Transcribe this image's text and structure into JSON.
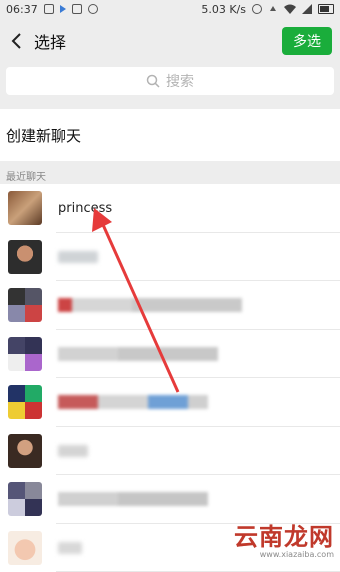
{
  "status_bar": {
    "time": "06:37",
    "network_speed": "5.03 K/s"
  },
  "header": {
    "back_icon": "chevron-left-icon",
    "title": "选择",
    "multi_select_label": "多选",
    "accent_color": "#1aad3b"
  },
  "search": {
    "placeholder": "搜索",
    "icon": "search-icon"
  },
  "create_new_chat": "创建新聊天",
  "recent_chats_label": "最近聊天",
  "chats": [
    {
      "name": "princess",
      "avatar": "portrait-brown"
    },
    {
      "name": "",
      "avatar": "portrait-man"
    },
    {
      "name": "",
      "avatar": "collage-group"
    },
    {
      "name": "",
      "avatar": "collage-group"
    },
    {
      "name": "",
      "avatar": "collage-colorful"
    },
    {
      "name": "",
      "avatar": "portrait-dark"
    },
    {
      "name": "",
      "avatar": "collage-group"
    },
    {
      "name": "",
      "avatar": "cartoon-pig"
    }
  ],
  "annotation": {
    "arrow_color": "#e63b3b",
    "description": "red arrow pointing to princess"
  },
  "watermark": {
    "main": "云南龙网",
    "sub": "www.xiazaiba.com"
  }
}
